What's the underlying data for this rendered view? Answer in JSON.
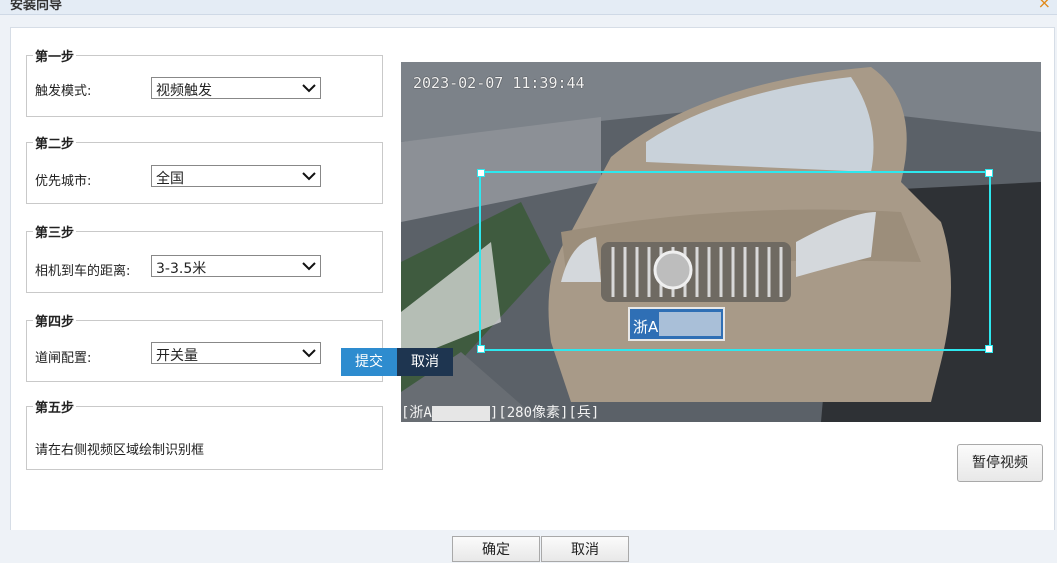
{
  "window": {
    "title": "安装向导",
    "close_glyph": "×"
  },
  "steps": [
    {
      "legend": "第一步",
      "label": "触发模式:",
      "value": "视频触发"
    },
    {
      "legend": "第二步",
      "label": "优先城市:",
      "value": "全国"
    },
    {
      "legend": "第三步",
      "label": "相机到车的距离:",
      "value": "3-3.5米"
    },
    {
      "legend": "第四步",
      "label": "道闸配置:",
      "value": "开关量"
    },
    {
      "legend": "第五步",
      "text": "请在右侧视频区域绘制识别框"
    }
  ],
  "video": {
    "timestamp": "2023-02-07 11:39:44",
    "plate_prefix": "浙A",
    "plate_info_left": "[浙A",
    "plate_info_right": "][280像素][兵]",
    "roi_color": "#2ee7ee"
  },
  "roi_actions": {
    "submit": "提交",
    "cancel": "取消"
  },
  "pause_button": "暂停视频",
  "footer": {
    "ok": "确定",
    "cancel": "取消"
  },
  "icons": {
    "dropdown": "chevron-down-icon",
    "close": "close-icon"
  }
}
